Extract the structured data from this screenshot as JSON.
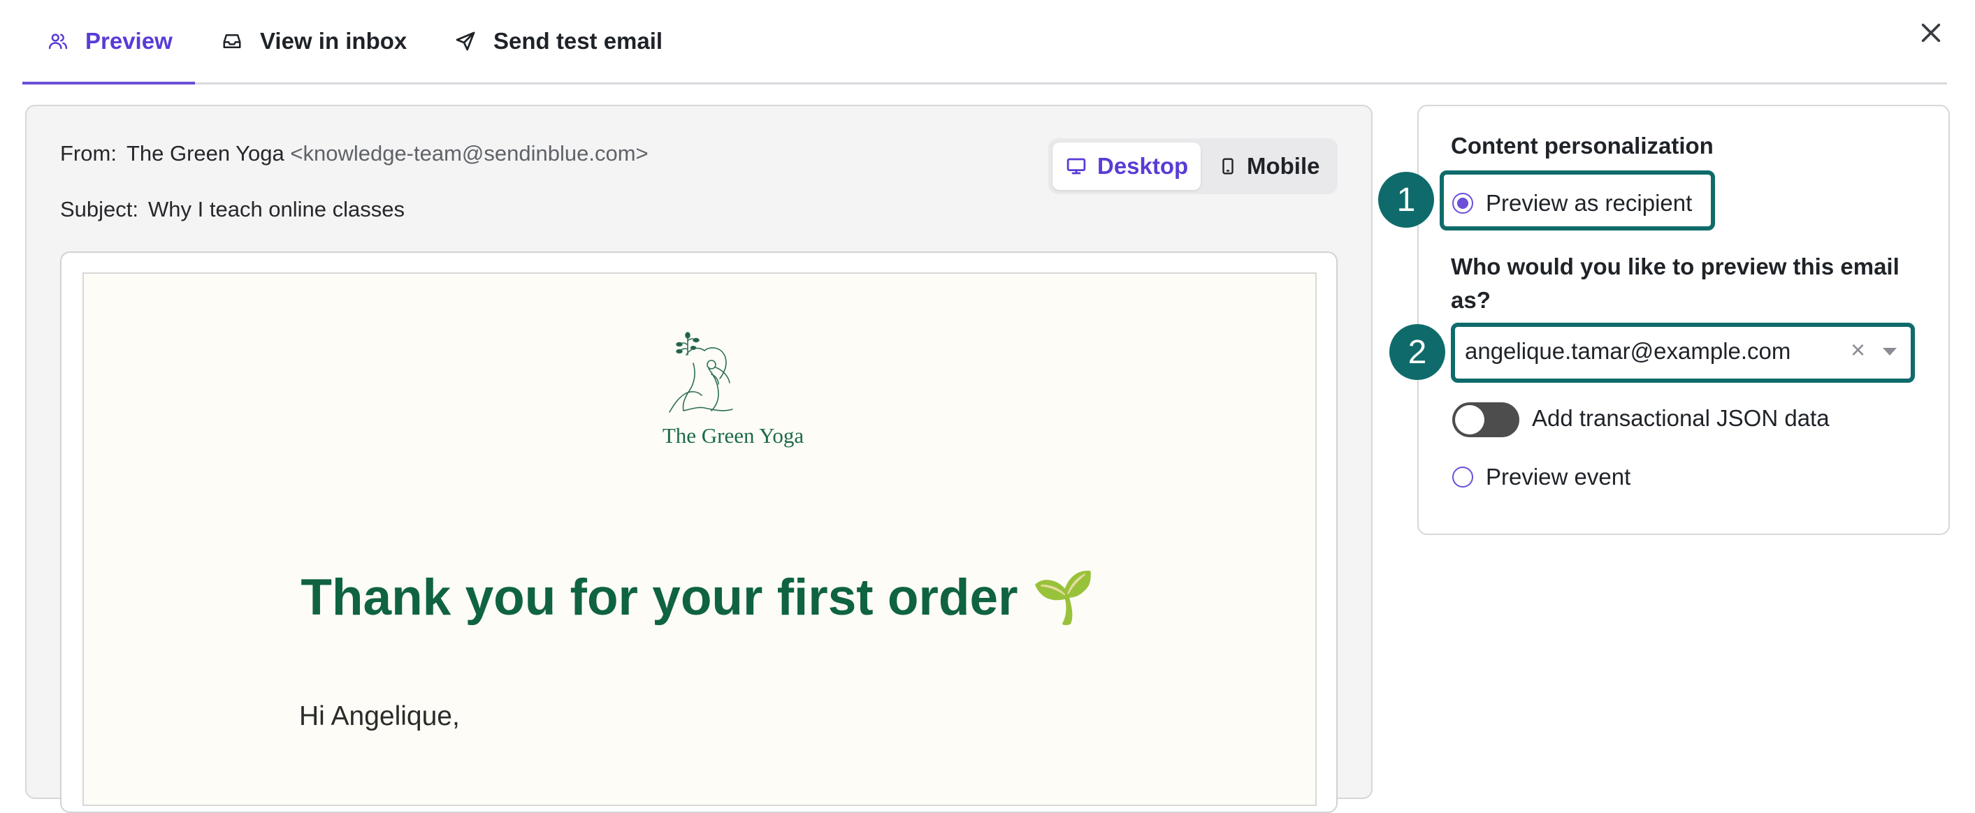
{
  "tabs": {
    "preview": "Preview",
    "view_in_inbox": "View in inbox",
    "send_test_email": "Send test email"
  },
  "email_meta": {
    "from_label": "From:",
    "from_name": "The Green Yoga",
    "from_address": "<knowledge-team@sendinblue.com>",
    "subject_label": "Subject:",
    "subject": "Why I teach online classes"
  },
  "device_toggle": {
    "desktop": "Desktop",
    "mobile": "Mobile",
    "selected": "Desktop"
  },
  "email_content": {
    "brand_name": "The Green Yoga",
    "headline": "Thank you for your first order 🌱",
    "greeting": "Hi Angelique,"
  },
  "settings": {
    "title": "Content personalization",
    "preview_as_recipient": "Preview as recipient",
    "who_question": "Who would you like to preview this email as?",
    "recipient_value": "angelique.tamar@example.com",
    "clear_symbol": "×",
    "json_toggle_label": "Add transactional JSON data",
    "json_toggle_on": false,
    "preview_event": "Preview event"
  },
  "annotations": {
    "step1": "1",
    "step2": "2"
  },
  "colors": {
    "accent": "#5a3bd6",
    "highlight": "#0f6b6b",
    "headline_green": "#0f6341"
  }
}
